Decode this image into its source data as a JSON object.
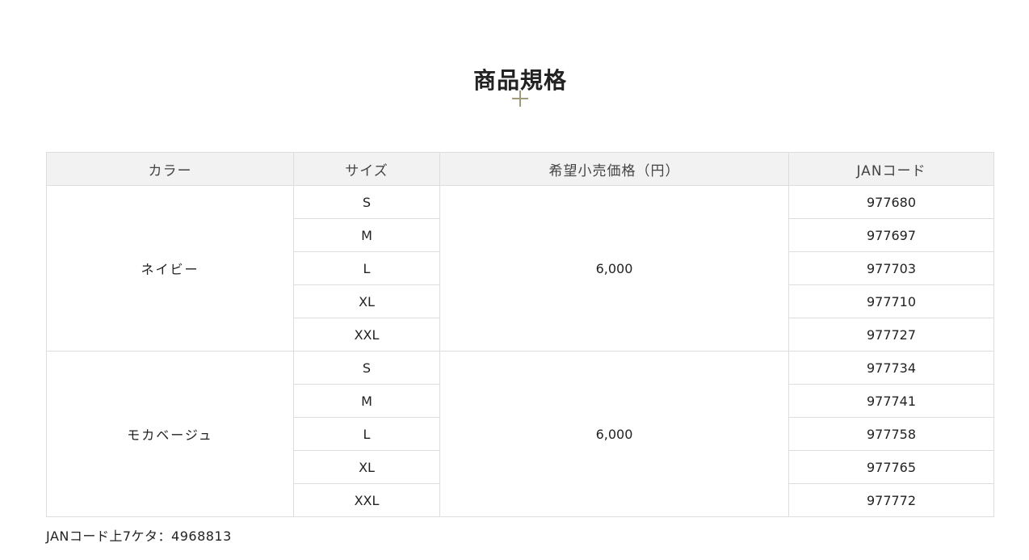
{
  "heading": {
    "title": "商品規格"
  },
  "table": {
    "headers": {
      "color": "カラー",
      "size": "サイズ",
      "price": "希望小売価格（円）",
      "jan": "JANコード"
    },
    "groups": [
      {
        "color": "ネイビー",
        "price": "6,000",
        "rows": [
          {
            "size": "S",
            "jan": "977680"
          },
          {
            "size": "M",
            "jan": "977697"
          },
          {
            "size": "L",
            "jan": "977703"
          },
          {
            "size": "XL",
            "jan": "977710"
          },
          {
            "size": "XXL",
            "jan": "977727"
          }
        ]
      },
      {
        "color": "モカベージュ",
        "price": "6,000",
        "rows": [
          {
            "size": "S",
            "jan": "977734"
          },
          {
            "size": "M",
            "jan": "977741"
          },
          {
            "size": "L",
            "jan": "977758"
          },
          {
            "size": "XL",
            "jan": "977765"
          },
          {
            "size": "XXL",
            "jan": "977772"
          }
        ]
      }
    ]
  },
  "note": "JANコード上7ケタ：4968813",
  "colors": {
    "accent": "#a09a78",
    "header_bg": "#f2f2f2",
    "border": "#dddddd"
  },
  "icons": {
    "divider": "plus-icon"
  }
}
